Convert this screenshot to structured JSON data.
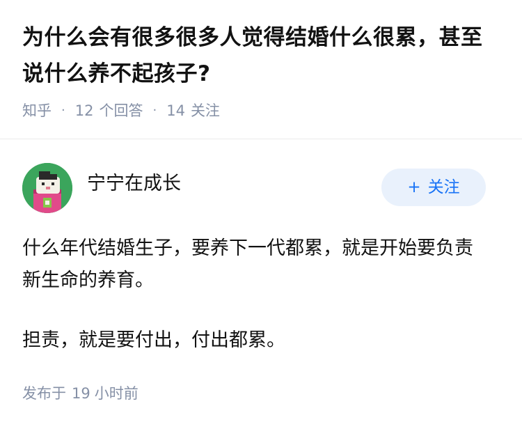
{
  "question": {
    "title": "为什么会有很多很多人觉得结婚什么很累，甚至说什么养不起孩子?",
    "source": "知乎",
    "answer_count": "12",
    "answer_label": "个回答",
    "follower_count": "14",
    "follower_label": "关注"
  },
  "answer": {
    "author": {
      "name": "宁宁在成长",
      "avatar_icon": "avatar-cartoon-icon"
    },
    "follow_button": {
      "icon": "plus-icon",
      "icon_glyph": "+",
      "label": "关注"
    },
    "paragraphs": [
      "什么年代结婚生子，要养下一代都累，就是开始要负责新生命的养育。",
      "担责，就是要付出，付出都累。"
    ],
    "published_prefix": "发布于",
    "published_number": "19",
    "published_unit": "小时前"
  },
  "colors": {
    "text_primary": "#121212",
    "text_secondary": "#8590a6",
    "accent": "#1772f6",
    "button_bg": "#e9f1fc",
    "avatar_bg": "#3ba55c"
  }
}
